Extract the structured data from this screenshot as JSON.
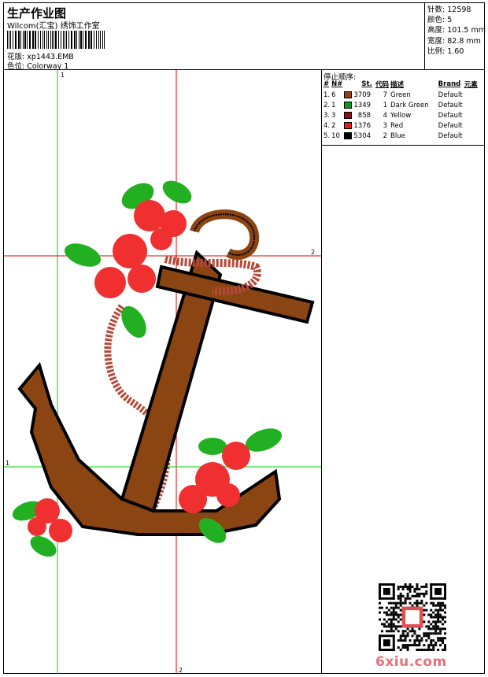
{
  "header": {
    "title": "生产作业图",
    "subtitle": "Wilcom(汇宝) 绣饰工作室",
    "design_label": "花版:",
    "design_file": "xp1443.EMB",
    "colorway_label": "色位:",
    "colorway": "Colorway 1"
  },
  "stats": [
    {
      "label": "针数:",
      "value": "12598"
    },
    {
      "label": "颜色:",
      "value": "5"
    },
    {
      "label": "高度:",
      "value": "101.5 mm"
    },
    {
      "label": "宽度:",
      "value": "82.8 mm"
    },
    {
      "label": "比例:",
      "value": "1.60"
    }
  ],
  "guides": {
    "v1_top": "1",
    "v2_bottom": "2",
    "h1_left": "1",
    "h2_right": "2"
  },
  "color_table": {
    "caption": "停止顺序:",
    "headers": [
      "#",
      "N#",
      "St.",
      "代码",
      "描述",
      "Brand",
      "元素"
    ],
    "rows": [
      {
        "order": "1.",
        "needle": "6",
        "color": "#8B4513",
        "stitches": "3709",
        "code": "7",
        "desc": "Green",
        "brand": "Default"
      },
      {
        "order": "2.",
        "needle": "1",
        "color": "#0a9a1a",
        "stitches": "1349",
        "code": "1",
        "desc": "Dark Green",
        "brand": "Default"
      },
      {
        "order": "3.",
        "needle": "3",
        "color": "#8a0f0f",
        "stitches": "858",
        "code": "4",
        "desc": "Yellow",
        "brand": "Default"
      },
      {
        "order": "4.",
        "needle": "2",
        "color": "#e21e1e",
        "stitches": "1376",
        "code": "3",
        "desc": "Red",
        "brand": "Default"
      },
      {
        "order": "5.",
        "needle": "10",
        "color": "#000000",
        "stitches": "5304",
        "code": "2",
        "desc": "Blue",
        "brand": "Default"
      }
    ]
  },
  "watermark": "6xiu.com",
  "colors": {
    "guide_green": "#00cc00",
    "guide_red": "#e00000",
    "anchor_brown": "#8B4513",
    "rope": "#b54a3a",
    "leaf_green": "#22b022",
    "flower_red": "#f03030"
  }
}
